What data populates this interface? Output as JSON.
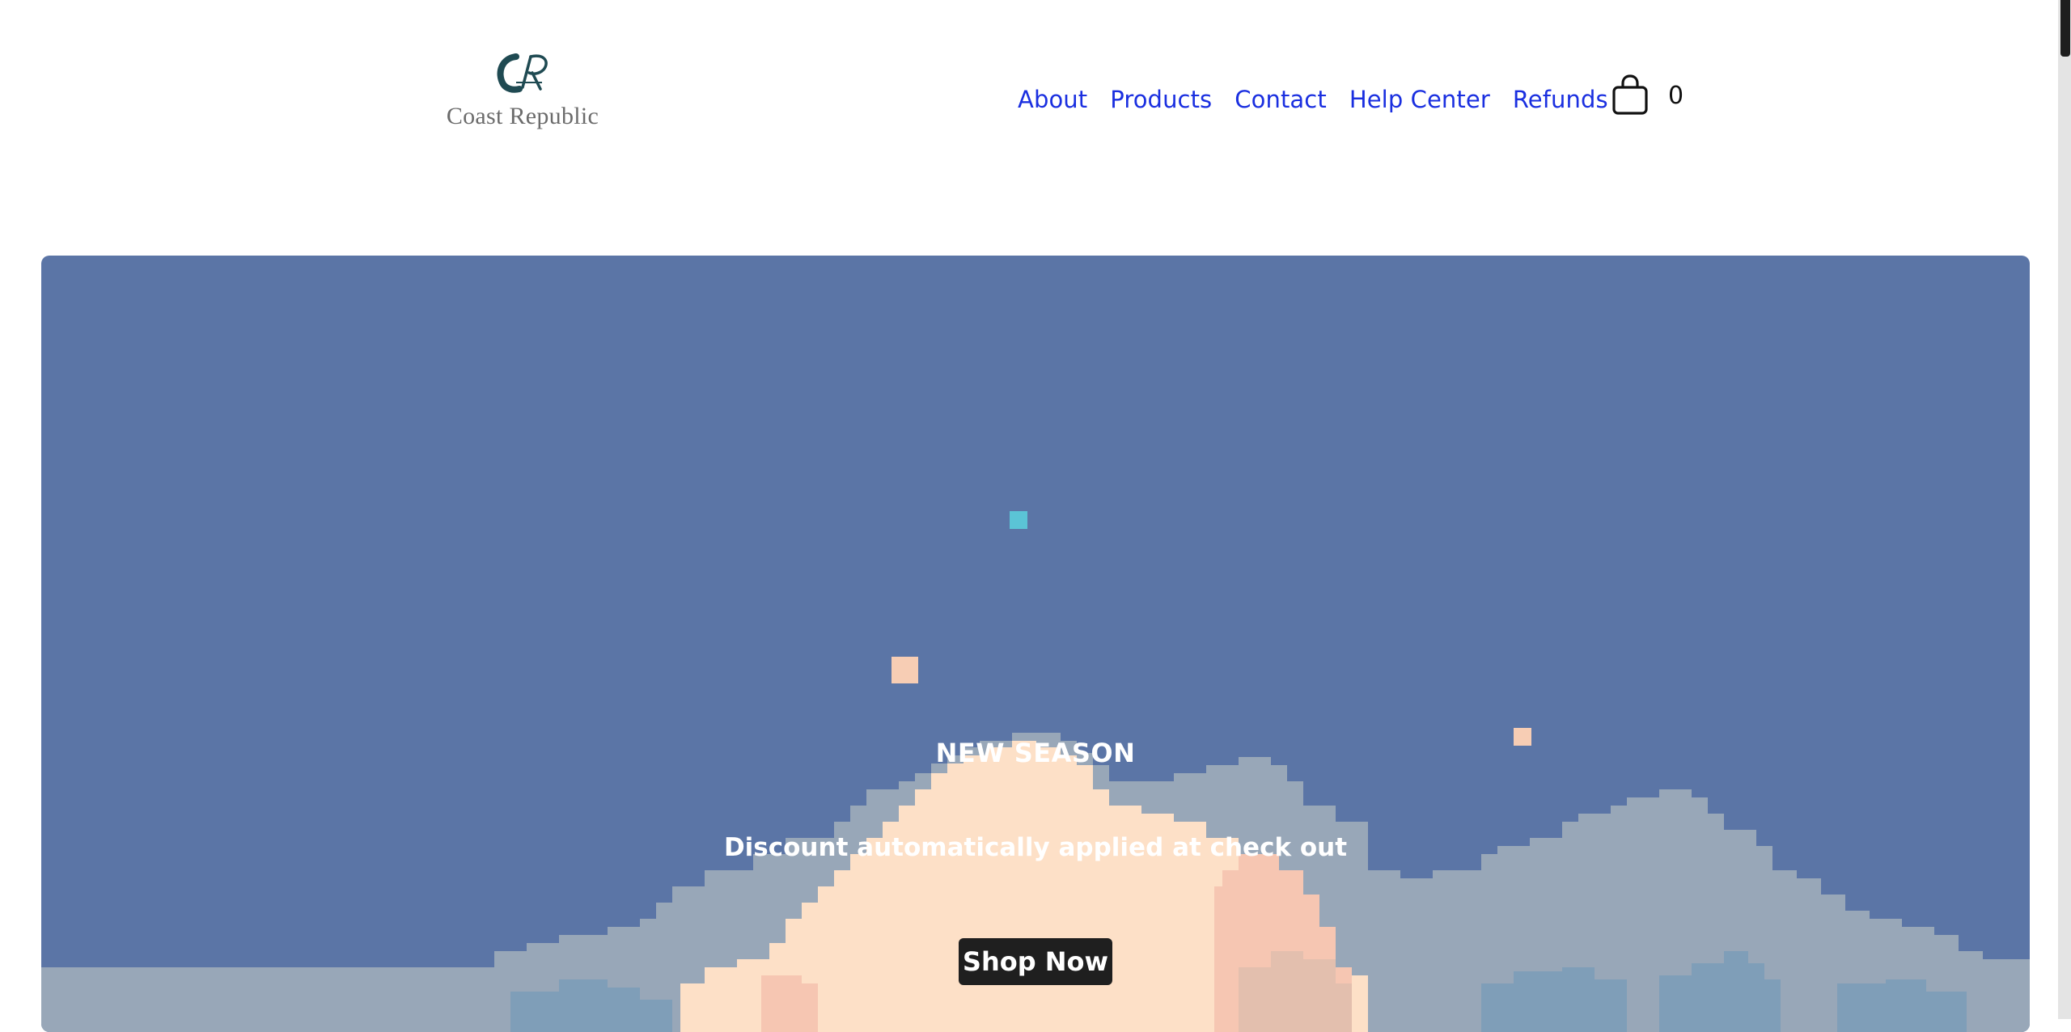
{
  "brand": {
    "name": "Coast Republic",
    "logo_icon": "cr-monogram-icon",
    "logo_color": "#1f4a52"
  },
  "nav": {
    "items": [
      {
        "label": "About"
      },
      {
        "label": "Products"
      },
      {
        "label": "Contact"
      },
      {
        "label": "Help Center"
      },
      {
        "label": "Refunds"
      }
    ],
    "link_color": "#1a2fe0"
  },
  "cart": {
    "icon": "shopping-bag-icon",
    "count": "0"
  },
  "hero": {
    "title": "NEW SEASON",
    "subtitle": "Discount automatically applied at check out",
    "cta_label": "Shop Now",
    "background_color": "#5b75a6"
  }
}
